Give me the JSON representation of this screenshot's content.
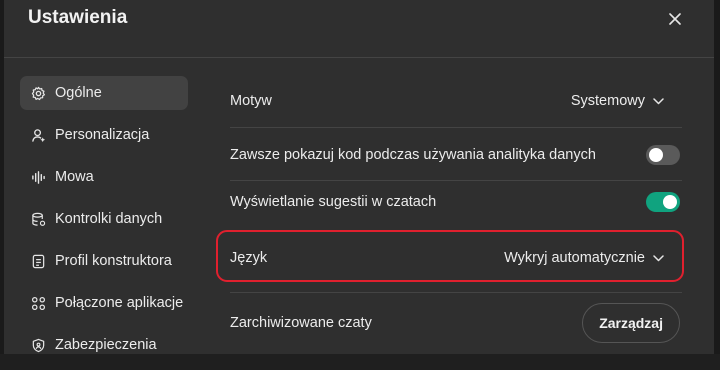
{
  "dialog": {
    "title": "Ustawienia",
    "close_label": "✕"
  },
  "sidebar": {
    "items": [
      {
        "label": "Ogólne",
        "icon": "gear-icon",
        "active": true
      },
      {
        "label": "Personalizacja",
        "icon": "person-icon",
        "active": false
      },
      {
        "label": "Mowa",
        "icon": "waveform-icon",
        "active": false
      },
      {
        "label": "Kontrolki danych",
        "icon": "database-icon",
        "active": false
      },
      {
        "label": "Profil konstruktora",
        "icon": "id-card-icon",
        "active": false
      },
      {
        "label": "Połączone aplikacje",
        "icon": "apps-grid-icon",
        "active": false
      },
      {
        "label": "Zabezpieczenia",
        "icon": "shield-icon",
        "active": false
      }
    ]
  },
  "settings": {
    "theme": {
      "label": "Motyw",
      "value": "Systemowy"
    },
    "show_code": {
      "label": "Zawsze pokazuj kod podczas używania analityka danych",
      "enabled": false
    },
    "suggestions": {
      "label": "Wyświetlanie sugestii w czatach",
      "enabled": true
    },
    "language": {
      "label": "Język",
      "value": "Wykryj automatycznie"
    },
    "archived": {
      "label": "Zarchiwizowane czaty",
      "button_label": "Zarządzaj"
    }
  },
  "colors": {
    "background": "#2f2f2f",
    "toggle_on": "#10a37f",
    "toggle_off": "#5a5a5a",
    "highlight": "#e0202e"
  }
}
